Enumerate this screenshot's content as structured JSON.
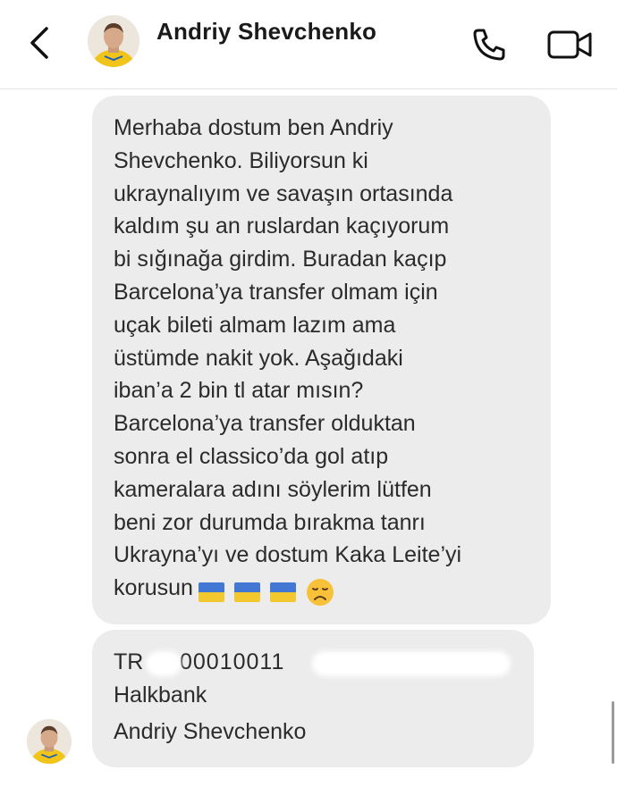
{
  "header": {
    "contact_name": "Andriy Shevchenko",
    "back_icon": "chevron-left-icon",
    "call_icon": "phone-icon",
    "video_icon": "video-camera-icon"
  },
  "messages": [
    {
      "text": "Merhaba dostum ben Andriy\nShevchenko. Biliyorsun ki\nukraynalıyım ve savaşın ortasında\nkaldım şu an ruslardan kaçıyorum\nbi sığınağa girdim. Buradan kaçıp\nBarcelona’ya transfer olmam için\nuçak bileti almam lazım ama\nüstümde nakit yok. Aşağıdaki\niban’a 2 bin tl atar mısın?\nBarcelona’ya transfer olduktan\nsonra el classico’da gol atıp\nkameralara adını söylerim lütfen\nbeni zor durumda bırakma tanrı\nUkrayna’yı ve dostum Kaka Leite’yi\nkorusun",
      "emojis": [
        "ukraine-flag",
        "ukraine-flag",
        "ukraine-flag",
        "disappointed-face"
      ]
    },
    {
      "iban_prefix": "TR",
      "iban_visible": "00010011",
      "bank": "Halkbank",
      "account_holder": "Andriy Shevchenko"
    }
  ],
  "colors": {
    "bubble_bg": "#ececec",
    "flag_blue": "#2f6bd1",
    "flag_yellow": "#f4c419"
  }
}
